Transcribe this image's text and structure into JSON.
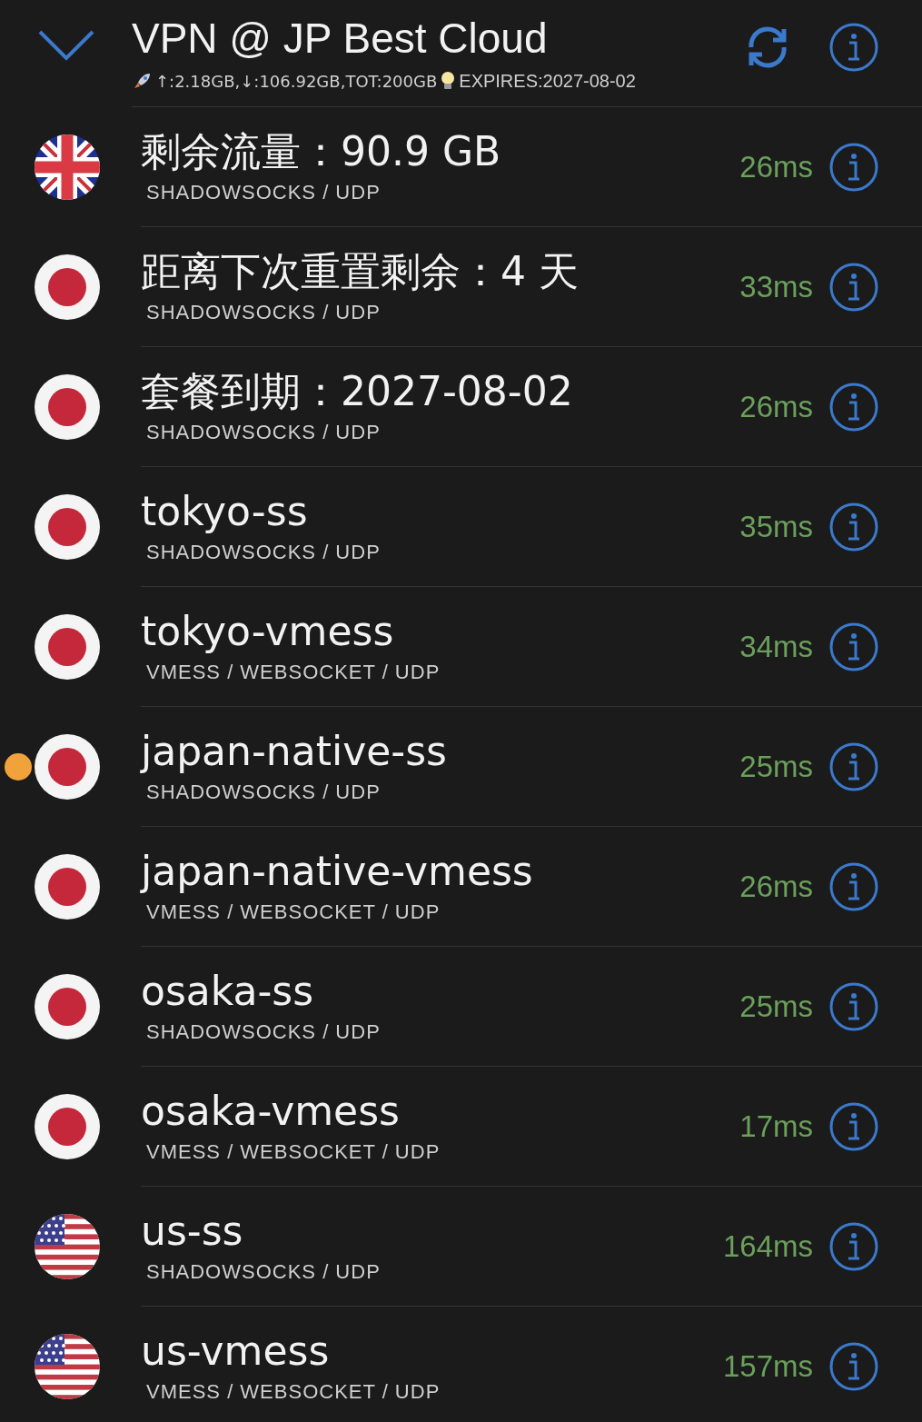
{
  "header": {
    "title": "VPN @ JP Best Cloud",
    "usage": "↑:2.18GB,↓:106.92GB,TOT:200GB",
    "expires": "EXPIRES:2027-08-02"
  },
  "servers": [
    {
      "kind": "uk",
      "name": "剩余流量：90.9 GB",
      "protocol": "SHADOWSOCKS / UDP",
      "latency": "26ms",
      "selected": false
    },
    {
      "kind": "jp",
      "name": "距离下次重置剩余：4 天",
      "protocol": "SHADOWSOCKS / UDP",
      "latency": "33ms",
      "selected": false
    },
    {
      "kind": "jp",
      "name": "套餐到期：2027-08-02",
      "protocol": "SHADOWSOCKS / UDP",
      "latency": "26ms",
      "selected": false
    },
    {
      "kind": "jp",
      "name": "tokyo-ss",
      "protocol": "SHADOWSOCKS / UDP",
      "latency": "35ms",
      "selected": false
    },
    {
      "kind": "jp",
      "name": "tokyo-vmess",
      "protocol": "VMESS / WEBSOCKET / UDP",
      "latency": "34ms",
      "selected": false
    },
    {
      "kind": "jp",
      "name": "japan-native-ss",
      "protocol": "SHADOWSOCKS / UDP",
      "latency": "25ms",
      "selected": true
    },
    {
      "kind": "jp",
      "name": "japan-native-vmess",
      "protocol": "VMESS / WEBSOCKET / UDP",
      "latency": "26ms",
      "selected": false
    },
    {
      "kind": "jp",
      "name": "osaka-ss",
      "protocol": "SHADOWSOCKS / UDP",
      "latency": "25ms",
      "selected": false
    },
    {
      "kind": "jp",
      "name": "osaka-vmess",
      "protocol": "VMESS / WEBSOCKET / UDP",
      "latency": "17ms",
      "selected": false
    },
    {
      "kind": "us",
      "name": "us-ss",
      "protocol": "SHADOWSOCKS / UDP",
      "latency": "164ms",
      "selected": false
    },
    {
      "kind": "us",
      "name": "us-vmess",
      "protocol": "VMESS / WEBSOCKET / UDP",
      "latency": "157ms",
      "selected": false
    }
  ]
}
